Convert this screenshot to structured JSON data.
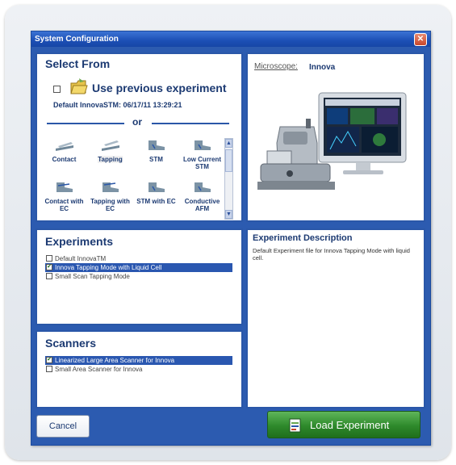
{
  "dialog": {
    "title": "System Configuration"
  },
  "select_from": {
    "heading": "Select From",
    "use_previous_label": "Use previous experiment",
    "default_info": "Default InnovaSTM: 06/17/11 13:29:21",
    "or_label": "or",
    "modes": [
      {
        "label": "Contact",
        "selected": false
      },
      {
        "label": "Tapping",
        "selected": true
      },
      {
        "label": "STM",
        "selected": false
      },
      {
        "label": "Low Current STM",
        "selected": false
      },
      {
        "label": "Contact with EC",
        "selected": false
      },
      {
        "label": "Tapping with EC",
        "selected": false
      },
      {
        "label": "STM with EC",
        "selected": false
      },
      {
        "label": "Conductive AFM",
        "selected": false
      }
    ]
  },
  "microscope": {
    "label": "Microscope:",
    "value": "Innova"
  },
  "experiments": {
    "heading": "Experiments",
    "items": [
      {
        "label": "Default InnovaTM",
        "checked": false,
        "selected": false
      },
      {
        "label": "Innova Tapping Mode with Liquid Cell",
        "checked": true,
        "selected": true
      },
      {
        "label": "Small Scan Tapping Mode",
        "checked": false,
        "selected": false
      }
    ]
  },
  "description": {
    "heading": "Experiment Description",
    "text": "Default Experiment file for Innova Tapping Mode with liquid cell."
  },
  "scanners": {
    "heading": "Scanners",
    "items": [
      {
        "label": "Linearized Large Area Scanner for Innova",
        "checked": true,
        "selected": true
      },
      {
        "label": "Small Area Scanner for Innova",
        "checked": false,
        "selected": false
      }
    ]
  },
  "buttons": {
    "cancel": "Cancel",
    "load": "Load Experiment"
  },
  "colors": {
    "accent": "#2a57a8",
    "load_green": "#2e8a2b",
    "title_blue": "#1c4fb5"
  }
}
